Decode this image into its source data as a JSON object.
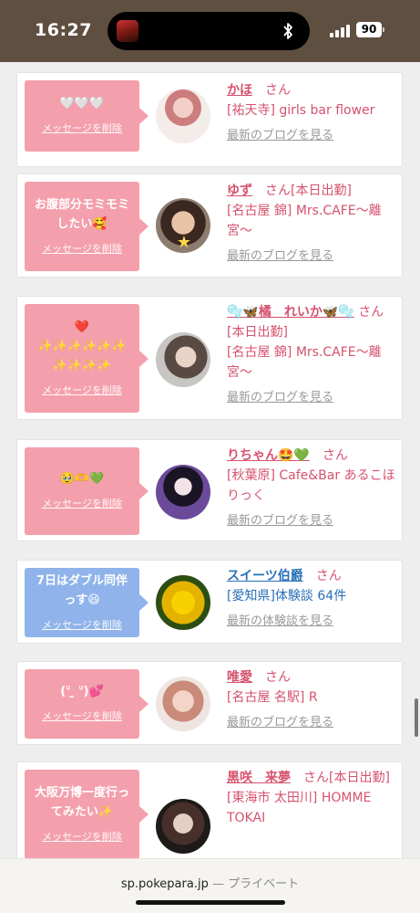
{
  "status": {
    "time": "16:27",
    "battery": "90"
  },
  "cards": [
    {
      "message": "🤍🤍🤍",
      "delete": "メッセージを削除",
      "name": "かほ",
      "san": "さん",
      "shop": "[祐天寺] girls bar flower",
      "link": "最新のブログを見る"
    },
    {
      "message": "お腹部分モミモミ\nしたい🥰",
      "delete": "メッセージを削除",
      "name": "ゆず",
      "san": "さん[本日出勤]",
      "shop": "[名古屋 錦] Mrs.CAFE〜離宮〜",
      "link": "最新のブログを見る"
    },
    {
      "message": "❤️\n✨✨✨✨✨✨\n✨✨✨✨",
      "delete": "メッセージを削除",
      "name": "🫧🦋橘　れいか🦋🫧",
      "san": "さん[本日出勤]",
      "shop": "[名古屋 錦] Mrs.CAFE〜離宮〜",
      "link": "最新のブログを見る"
    },
    {
      "message": "🥹🫶💚",
      "delete": "メッセージを削除",
      "name": "りちゃん🤩💚",
      "san": "さん",
      "shop": "[秋葉原] Cafe&Bar あるこほりっく",
      "link": "最新のブログを見る"
    },
    {
      "message": "7日はダブル同伴\nっす😆",
      "delete": "メッセージを削除",
      "name": "スイーツ伯爵",
      "san": "さん",
      "shop": "[愛知県]体験談 64件",
      "link": "最新の体験談を見る"
    },
    {
      "message": "(ᐡ ̫ ᐡ)💕",
      "delete": "メッセージを削除",
      "name": "唯愛",
      "san": "さん",
      "shop": "[名古屋 名駅] R",
      "link": "最新のブログを見る"
    },
    {
      "message": "大阪万博一度行っ\nてみたい✨",
      "delete": "メッセージを削除",
      "name": "黒咲　来夢",
      "san": "さん[本日出勤]",
      "shop": "[東海市 太田川] HOMME TOKAI",
      "link": "最新のブログを見る"
    }
  ],
  "browser": {
    "url": "sp.pokepara.jp",
    "separator": "—",
    "mode": "プライベート"
  }
}
